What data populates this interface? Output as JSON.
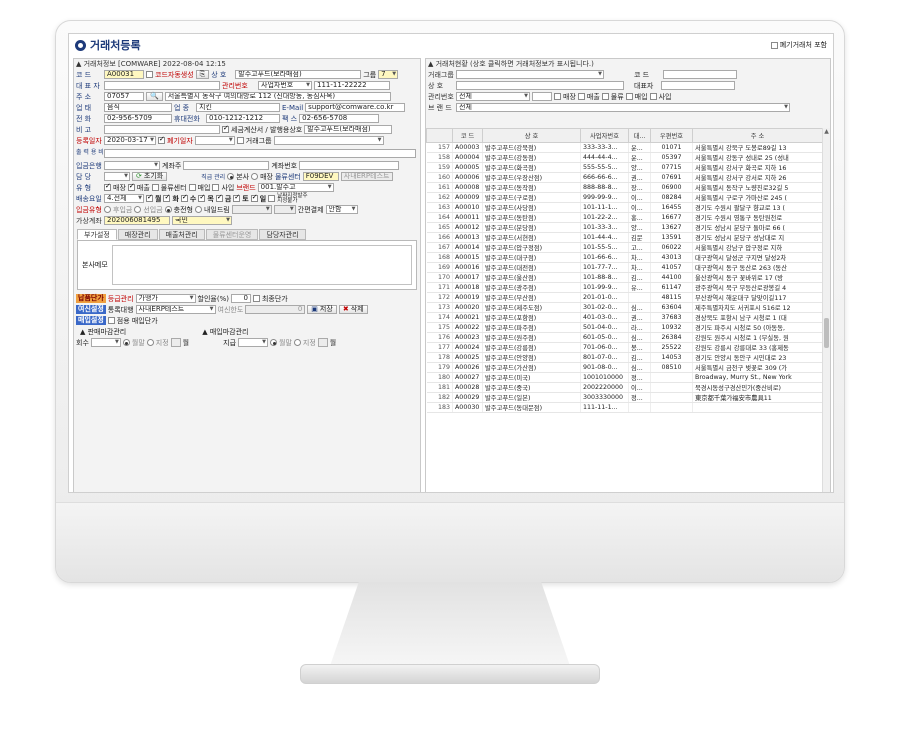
{
  "window": {
    "title": "거래처등록",
    "closed_check_label": "폐기거래처 포함"
  },
  "left": {
    "group_title": "거래처정보",
    "group_meta": "[COMWARE] 2022-08-04 12:15",
    "code_label": "코 드",
    "code_value": "A00031",
    "autogen_label": "코드자동생성",
    "name_label": "상 호",
    "name_value": "발주고푸드(보라매점)",
    "grade_label": "그룹",
    "grade_value": "7",
    "ceo_label": "대 표 자",
    "ceo_value": "",
    "bizno_label": "관리번호",
    "bizno_type": "사업자번호",
    "bizno_value": "111-11-22222",
    "addr_label": "주 소",
    "zip_value": "07057",
    "addr_value": "서울특별시 동작구 여의대방로 112 (신대방동, 동심사옥)",
    "biztype_label": "업 태",
    "biztype_value": "음식",
    "bizitem_label": "업 종",
    "bizitem_value": "치킨",
    "email_label": "E-Mail",
    "email_value": "support@comware.co.kr",
    "tel_label": "전 화",
    "tel_value": "02-956-5709",
    "mobile_label": "휴대전화",
    "mobile_value": "010-1212-1212",
    "fax_label": "팩 스",
    "fax_value": "02-656-5708",
    "note_label": "비 고",
    "tax_check_label": "세금계산서 / 발행용상호",
    "tax_name_value": "발주고푸드(보라매점)",
    "regdate_label": "등록일자",
    "regdate_value": "2020-03-17",
    "closedate_label": "폐기일자",
    "group2_label": "거래그룹",
    "manager_label": "출 력 용 비 고",
    "bank_label": "입금은행",
    "account_label": "계좌주",
    "account_no_label": "계좌번호",
    "sales_label": "담 당",
    "reset_label": "초기화",
    "rel_label": "직급 관리",
    "rel_opt1": "본사",
    "rel_opt2": "매장",
    "center_label": "물류센터",
    "center_code": "F09DEV",
    "center_name": "사내ERP테스트",
    "type_label": "유 형",
    "type_opts": [
      "매장",
      "매출",
      "물류센터",
      "매입",
      "사입"
    ],
    "brand_label": "브랜드",
    "brand_value": "001.발주고",
    "day_label": "배송요일",
    "day_value": "4.전체",
    "days": [
      "월",
      "화",
      "수",
      "목",
      "금",
      "토",
      "일"
    ],
    "allday_label": "날짜지정발주",
    "allday_label2": "지정불가",
    "pay_label": "입금유형",
    "pay_opts": [
      "후입금",
      "선입금",
      "충전형",
      "내일드림"
    ],
    "pay_tail_label": "간편결제",
    "pay_tail_value": "안함",
    "vacct_label": "가상계좌",
    "vacct_value": "202006081495",
    "vacct_bank": "국민",
    "tabs": [
      "부가설정",
      "매장관리",
      "매출처관리",
      "물류센터운영",
      "담당자관리"
    ],
    "memo_label": "본사메모",
    "price_tag": "납품단가",
    "price_label": "등급관리",
    "price_value": "가맹가",
    "discount_label": "할인율(%)",
    "discount_value": "0",
    "lastprice_label": "최종단가",
    "sync_tag": "여신설정",
    "sync_label": "통록대행",
    "sync_value": "사내ERP테스트",
    "sync_target": "여신한도",
    "sync_amount": "0",
    "save_label": "저장",
    "delete_label": "삭제",
    "buy_tag": "매입설정",
    "buy_check_label": "점용 매입단가",
    "sale_group": "판매마감관리",
    "buy_group": "매입마감관리",
    "sale_cnt_label": "회수",
    "buy_cnt_label": "지급",
    "opt_month": "월말",
    "opt_day": "지정",
    "unit_month": "월"
  },
  "right": {
    "group_title": "거래처현황 (상호 클릭하면 거래처정보가 표시됩니다.)",
    "f_group_label": "거래그룹",
    "f_code_label": "코 드",
    "f_name_label": "상 호",
    "f_ceo_label": "대표자",
    "f_mgmt_label": "관리번호",
    "f_mgmt_value": "전체",
    "f_checks": [
      "매장",
      "매출",
      "물류",
      "매입",
      "사입"
    ],
    "f_brand_label": "브 랜 드",
    "f_brand_value": "전체",
    "columns": [
      "",
      "코 드",
      "상 호",
      "사업자번호",
      "대...",
      "우편번호",
      "주 소"
    ],
    "rows": [
      [
        "157",
        "A00003",
        "발주고푸드(강북점)",
        "333-33-3...",
        "윤...",
        "01071",
        "서울특별시 강북구 도봉로89길 13"
      ],
      [
        "158",
        "A00004",
        "발주고푸드(강동점)",
        "444-44-4...",
        "윤...",
        "05397",
        "서울특별시 강동구 성내로 25 (성내"
      ],
      [
        "159",
        "A00005",
        "발주고푸드(화곡점)",
        "555-55-5...",
        "양...",
        "07715",
        "서울특별시 강서구 화곡로 지하 16"
      ],
      [
        "160",
        "A00006",
        "발주고푸드(우장산점)",
        "666-66-6...",
        "권...",
        "07691",
        "서울특별시 강서구 강서로 지하 26"
      ],
      [
        "161",
        "A00008",
        "발주고푸드(동작점)",
        "888-88-8...",
        "장...",
        "06900",
        "서울특별시 동작구 노량진로32길 5"
      ],
      [
        "162",
        "A00009",
        "발주고푸드(구로점)",
        "999-99-9...",
        "이...",
        "08284",
        "서울특별시 구로구 가마산로 245 ("
      ],
      [
        "163",
        "A00010",
        "발주고푸드(사당점)",
        "101-11-1...",
        "이...",
        "16455",
        "경기도 수원시 팔달구 향교로 13 ("
      ],
      [
        "164",
        "A00011",
        "발주고푸드(동탄점)",
        "101-22-2...",
        "홍...",
        "16677",
        "경기도 수원시 영통구 동탄원천로"
      ],
      [
        "165",
        "A00012",
        "발주고푸드(분당점)",
        "101-33-3...",
        "양...",
        "13627",
        "경기도 성남시 분당구 돌마로 66 ("
      ],
      [
        "166",
        "A00013",
        "발주고푸드(서현점)",
        "101-44-4...",
        "김문",
        "13591",
        "경기도 성남시 분당구 성남대로 지"
      ],
      [
        "167",
        "A00014",
        "발주고푸드(압구정점)",
        "101-55-5...",
        "고...",
        "06022",
        "서울특별시 강남구 압구정로 지하"
      ],
      [
        "168",
        "A00015",
        "발주고푸드(대구점)",
        "101-66-6...",
        "차...",
        "43013",
        "대구광역시 달성군 구지면 달성2차"
      ],
      [
        "169",
        "A00016",
        "발주고푸드(대전점)",
        "101-77-7...",
        "차...",
        "41057",
        "대구광역시 동구 동산로 263 (동산"
      ],
      [
        "170",
        "A00017",
        "발주고푸드(울산점)",
        "101-88-8...",
        "김...",
        "44100",
        "울산광역시 동구 꽃바위로 17 (방"
      ],
      [
        "171",
        "A00018",
        "발주고푸드(광주점)",
        "101-99-9...",
        "유...",
        "61147",
        "광주광역시 북구 무등산로광봉길 4"
      ],
      [
        "172",
        "A00019",
        "발주고푸드(부산점)",
        "201-01-0...",
        "",
        "48115",
        "부산광역시 해운대구 달맞이길117"
      ],
      [
        "173",
        "A00020",
        "발주고푸드(제주도점)",
        "301-02-0...",
        "심...",
        "63604",
        "제주특별자치도 서귀포시 516로 12"
      ],
      [
        "174",
        "A00021",
        "발주고푸드(포항점)",
        "401-03-0...",
        "권...",
        "37683",
        "경상북도 포항시 남구 시청로 1 (대"
      ],
      [
        "175",
        "A00022",
        "발주고푸드(파주점)",
        "501-04-0...",
        "라...",
        "10932",
        "경기도 파주시 시청로 50 (아동동,"
      ],
      [
        "176",
        "A00023",
        "발주고푸드(원주점)",
        "601-05-0...",
        "심...",
        "26384",
        "강원도 원주시 시청로 1 (무실동, 원"
      ],
      [
        "177",
        "A00024",
        "발주고푸드(강릉점)",
        "701-06-0...",
        "봉...",
        "25522",
        "강원도 강릉시 강릉대로 33 (홍제동"
      ],
      [
        "178",
        "A00025",
        "발주고푸드(안양점)",
        "801-07-0...",
        "김...",
        "14053",
        "경기도 안양시 동안구 시민대로 23"
      ],
      [
        "179",
        "A00026",
        "발주고푸드(가산점)",
        "901-08-0...",
        "심...",
        "08510",
        "서울특별시 금천구 벚꽃로 309 (가"
      ],
      [
        "180",
        "A00027",
        "발주고푸드(미국)",
        "1001010000",
        "정...",
        "",
        "Broadway, Murry St., New York"
      ],
      [
        "181",
        "A00028",
        "발주고푸드(중국)",
        "2002220000",
        "이...",
        "",
        "북경시동성구경산민가(중산비로)"
      ],
      [
        "182",
        "A00029",
        "발주고푸드(일본)",
        "3003330000",
        "정...",
        "",
        "東京都千葉가福安市農具11"
      ],
      [
        "183",
        "A00030",
        "발주고푸드(동대문점)",
        "111-11-1...",
        "",
        "",
        ""
      ]
    ]
  },
  "colors": {
    "title": "#1d3a7a",
    "label_blue": "#1d3a7a",
    "label_red": "#c00000",
    "tag_orange": "#f0a040",
    "tag_blue": "#3a68c8"
  }
}
